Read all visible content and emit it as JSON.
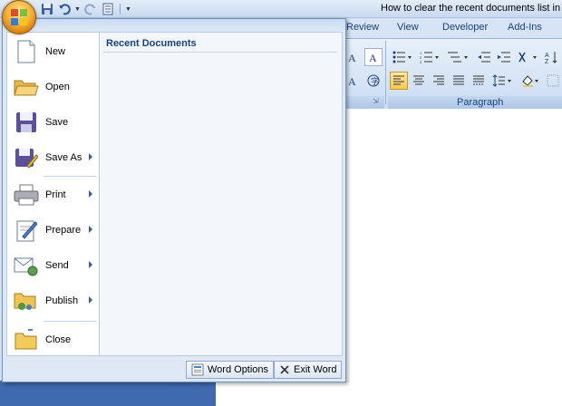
{
  "window": {
    "title": "How to clear the recent documents list in"
  },
  "ribbon": {
    "tabs": [
      "Review",
      "View",
      "Developer",
      "Add-Ins"
    ],
    "paragraph_group_label": "Paragraph"
  },
  "office_menu": {
    "items": [
      {
        "label": "New",
        "icon": "new-document-icon",
        "has_submenu": false
      },
      {
        "label": "Open",
        "icon": "open-folder-icon",
        "has_submenu": false
      },
      {
        "label": "Save",
        "icon": "save-disk-icon",
        "has_submenu": false
      },
      {
        "label": "Save As",
        "icon": "save-as-icon",
        "has_submenu": true
      },
      {
        "label": "Print",
        "icon": "printer-icon",
        "has_submenu": true
      },
      {
        "label": "Prepare",
        "icon": "prepare-icon",
        "has_submenu": true
      },
      {
        "label": "Send",
        "icon": "send-icon",
        "has_submenu": true
      },
      {
        "label": "Publish",
        "icon": "publish-icon",
        "has_submenu": true
      },
      {
        "label": "Close",
        "icon": "close-folder-icon",
        "has_submenu": false
      }
    ],
    "recent_documents_title": "Recent Documents",
    "word_options_label": "Word Options",
    "exit_word_label": "Exit Word"
  },
  "colors": {
    "accent_text": "#15428b",
    "menu_border": "#6e93c4",
    "orb_orange": "#f7b234"
  }
}
